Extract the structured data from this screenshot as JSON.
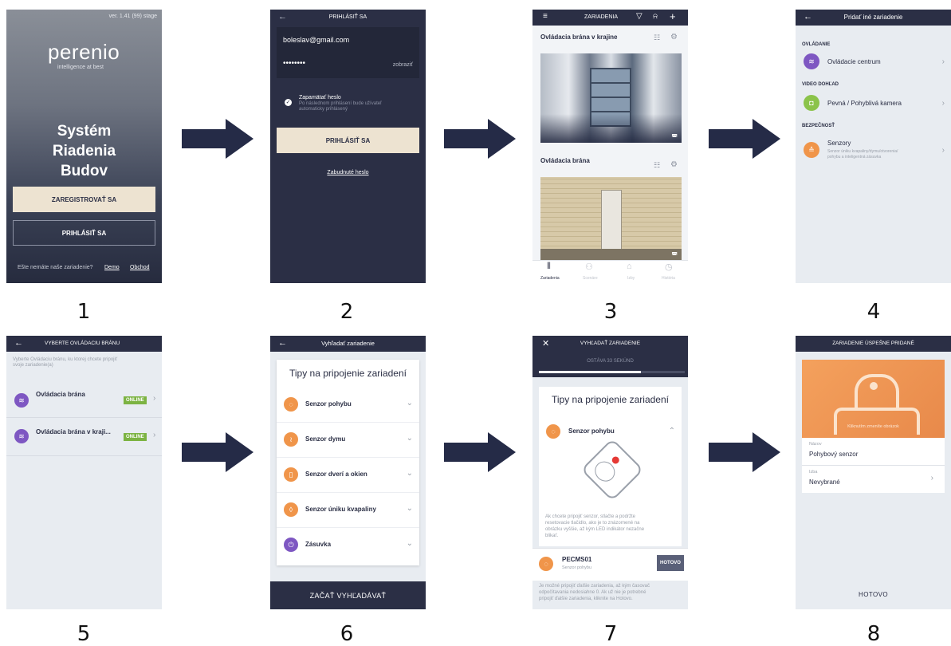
{
  "step_numbers": [
    "1",
    "2",
    "3",
    "4",
    "5",
    "6",
    "7",
    "8"
  ],
  "s1": {
    "version": "ver. 1.41 (99) stage",
    "brand": "perenio",
    "tagline": "intelligence at best",
    "title_line1": "Systém",
    "title_line2": "Riadenia",
    "title_line3": "Budov",
    "register_label": "ZAREGISTROVAŤ SA",
    "login_label": "PRIHLÁSIŤ SA",
    "footer_text": "Ešte nemáte naše zariadenie?",
    "demo_link": "Demo",
    "shop_link": "Obchod"
  },
  "s2": {
    "header_title": "PRIHLÁSIŤ SA",
    "email_value": "boleslav@gmail.com",
    "password_value": "••••••••",
    "show_label": "zobraziť",
    "remember_title": "Zapamätať heslo",
    "remember_desc_line1": "Po následnom prihlásení bude užívateľ",
    "remember_desc_line2": "automaticky prihlásený",
    "login_button": "PRIHLÁSIŤ SA",
    "forgot_link": "Zabudnuté heslo"
  },
  "s3": {
    "header_title": "ZARIADENIA",
    "gateway1_title": "Ovládacia brána v krajine",
    "gateway2_title": "Ovládacia brána",
    "tabs": [
      "Zariadenia",
      "Scenáre",
      "Izby",
      "História"
    ]
  },
  "s4": {
    "header_title": "Pridať iné zariadenie",
    "section1": "OVLÁDANIE",
    "item1": "Ovládacie centrum",
    "section2": "VIDEO DOHĽAD",
    "item2": "Pevná / Pohyblivá kamera",
    "section3": "BEZPEČNOSŤ",
    "item3": "Senzory",
    "item3_desc_line1": "Senzor úniku kvapaliny/dymu/otvorenia/",
    "item3_desc_line2": "pohybu a inteligentná zásuvka"
  },
  "s5": {
    "header_title": "VYBERTE OVLÁDACIU BRÁNU",
    "desc_line1": "Vyberte Ovládaciu bránu, ku ktorej chcete pripojiť",
    "desc_line2": "svoje zariadenie(a)",
    "gw1": "Ovládacia brána",
    "gw2": "Ovládacia brána v kraji...",
    "status": "ONLINE"
  },
  "s6": {
    "header_title": "Vyhľadať zariadenie",
    "card_title": "Tipy na pripojenie zariadení",
    "items": [
      "Senzor pohybu",
      "Senzor dymu",
      "Senzor dverí a okien",
      "Senzor úniku kvapaliny",
      "Zásuvka"
    ],
    "start_button": "ZAČAŤ VYHĽADÁVAŤ"
  },
  "s7": {
    "header_title": "VYHĽADAŤ ZARIADENIE",
    "countdown": "OSTÁVA 33 SEKÚND",
    "progress": 0.7,
    "card_title": "Tipy na pripojenie zariadení",
    "sensor": "Senzor pohybu",
    "instr_line1": "Ak chcete pripojiť senzor, stlačte a podržte",
    "instr_line2": "resetovacie tlačidlo, ako je to znázornené na",
    "instr_line3": "obrázku vyššie, až kým LED indikátor nezačne",
    "instr_line4": "blikať.",
    "found_name": "PECMS01",
    "found_type": "Senzor pohybu",
    "done_button": "HOTOVO",
    "note_line1": "Je možné pripojiť ďalšie zariadenia, až kým časovač",
    "note_line2": "odpočítavania nedosiahne 0. Ak už nie je potrebné",
    "note_line3": "pripojiť ďalšie zariadenia, kliknite na Hotovo."
  },
  "s8": {
    "header_title": "ZARIADENIE ÚSPEŠNE PRIDANÉ",
    "image_hint": "Kliknutím zmeníte obrázok",
    "name_label": "Názov",
    "name_value": "Pohybový senzor",
    "room_label": "Izba",
    "room_value": "Nevybrané",
    "done_label": "HOTOVO"
  },
  "colors": {
    "navy": "#2b2f45",
    "cream": "#ede3d1",
    "purple": "#7e57c2",
    "orange": "#f0954a",
    "green": "#8bc34a",
    "online": "#7cb342"
  }
}
